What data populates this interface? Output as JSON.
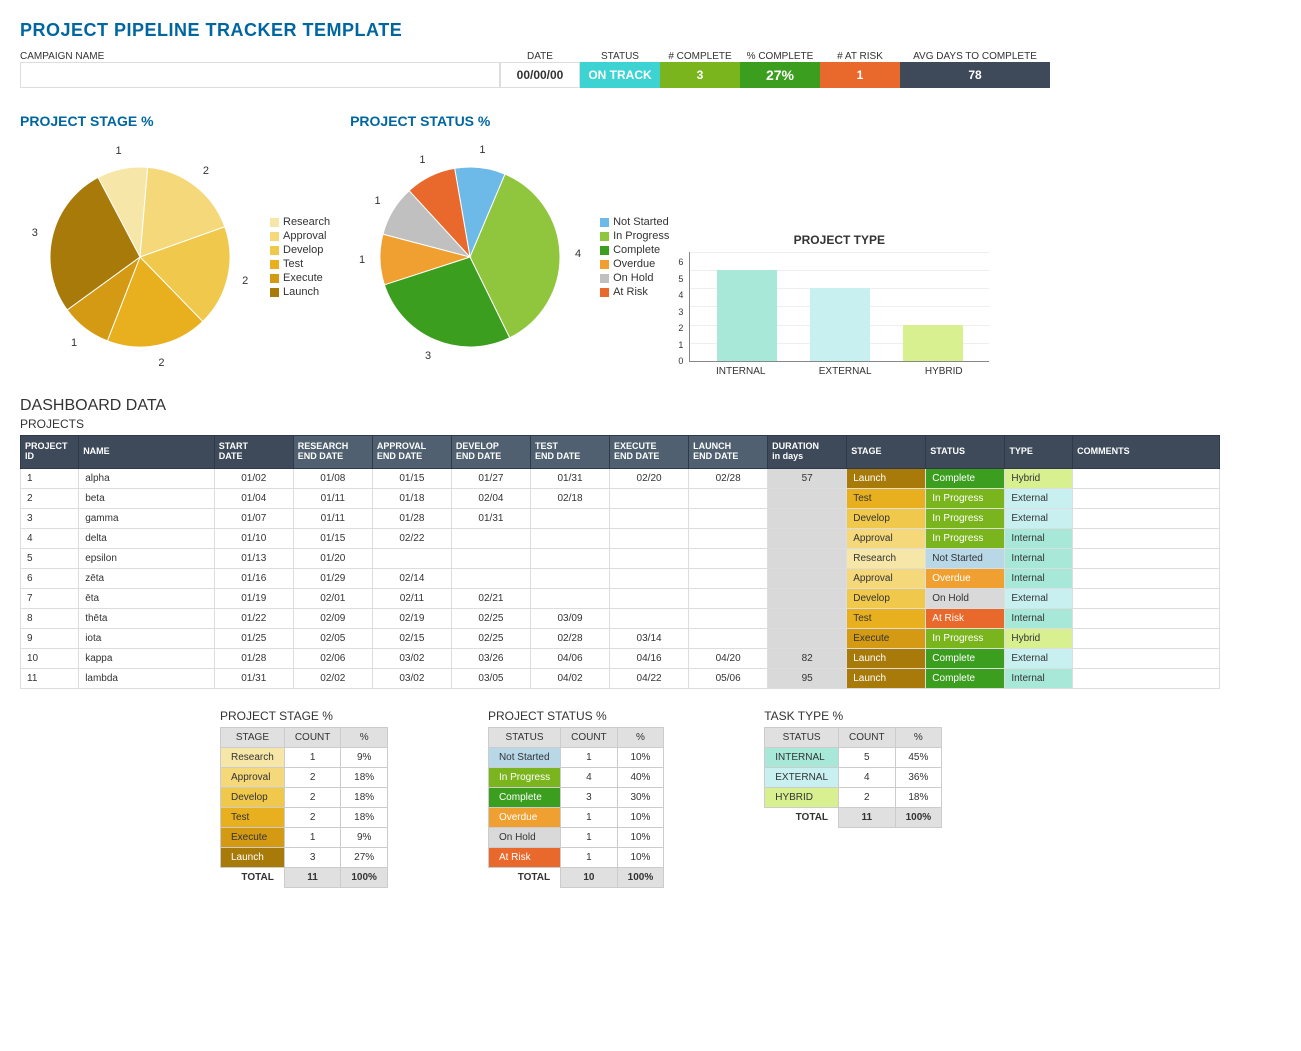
{
  "title": "PROJECT PIPELINE TRACKER TEMPLATE",
  "header": {
    "labels": {
      "campaign": "CAMPAIGN NAME",
      "date": "DATE",
      "status": "STATUS",
      "num_complete": "# COMPLETE",
      "pct_complete": "% COMPLETE",
      "at_risk": "# AT RISK",
      "avg_days": "AVG DAYS TO COMPLETE"
    },
    "values": {
      "date": "00/00/00",
      "status": "ON TRACK",
      "num_complete": "3",
      "pct_complete": "27%",
      "at_risk": "1",
      "avg_days": "78"
    }
  },
  "charts": {
    "stage": {
      "title": "PROJECT STAGE %"
    },
    "status": {
      "title": "PROJECT STATUS %"
    },
    "type": {
      "title": "PROJECT TYPE"
    }
  },
  "chart_data": [
    {
      "type": "pie",
      "title": "PROJECT STAGE %",
      "categories": [
        "Research",
        "Approval",
        "Develop",
        "Test",
        "Execute",
        "Launch"
      ],
      "values": [
        1,
        2,
        2,
        2,
        1,
        3
      ],
      "colors": [
        "#f6e7a8",
        "#f5d87a",
        "#f0c84c",
        "#e8b01e",
        "#d49a14",
        "#a87a0a"
      ]
    },
    {
      "type": "pie",
      "title": "PROJECT STATUS %",
      "categories": [
        "Not Started",
        "In Progress",
        "Complete",
        "Overdue",
        "On Hold",
        "At Risk"
      ],
      "values": [
        1,
        4,
        3,
        1,
        1,
        1
      ],
      "colors": [
        "#6db9e8",
        "#8fc63d",
        "#3c9e1f",
        "#f0a030",
        "#c0c0c0",
        "#e8692b"
      ]
    },
    {
      "type": "bar",
      "title": "PROJECT TYPE",
      "categories": [
        "INTERNAL",
        "EXTERNAL",
        "HYBRID"
      ],
      "values": [
        5,
        4,
        2
      ],
      "colors": [
        "#a8e8d8",
        "#c8f0f0",
        "#d8f090"
      ],
      "ylim": [
        0,
        6
      ],
      "yticks": [
        0,
        1,
        2,
        3,
        4,
        5,
        6
      ]
    }
  ],
  "dashboard_title": "DASHBOARD DATA",
  "projects_title": "PROJECTS",
  "projects": {
    "headers": [
      "PROJECT ID",
      "NAME",
      "START DATE",
      "RESEARCH END DATE",
      "APPROVAL END DATE",
      "DEVELOP END DATE",
      "TEST END DATE",
      "EXECUTE END DATE",
      "LAUNCH END DATE",
      "DURATION in days",
      "STAGE",
      "STATUS",
      "TYPE",
      "COMMENTS"
    ],
    "rows": [
      {
        "id": "1",
        "name": "alpha",
        "start": "01/02",
        "research": "01/08",
        "approval": "01/15",
        "develop": "01/27",
        "test": "01/31",
        "execute": "02/20",
        "launch": "02/28",
        "duration": "57",
        "stage": "Launch",
        "status": "Complete",
        "type": "Hybrid",
        "comments": ""
      },
      {
        "id": "2",
        "name": "beta",
        "start": "01/04",
        "research": "01/11",
        "approval": "01/18",
        "develop": "02/04",
        "test": "02/18",
        "execute": "",
        "launch": "",
        "duration": "",
        "stage": "Test",
        "status": "In Progress",
        "type": "External",
        "comments": ""
      },
      {
        "id": "3",
        "name": "gamma",
        "start": "01/07",
        "research": "01/11",
        "approval": "01/28",
        "develop": "01/31",
        "test": "",
        "execute": "",
        "launch": "",
        "duration": "",
        "stage": "Develop",
        "status": "In Progress",
        "type": "External",
        "comments": ""
      },
      {
        "id": "4",
        "name": "delta",
        "start": "01/10",
        "research": "01/15",
        "approval": "02/22",
        "develop": "",
        "test": "",
        "execute": "",
        "launch": "",
        "duration": "",
        "stage": "Approval",
        "status": "In Progress",
        "type": "Internal",
        "comments": ""
      },
      {
        "id": "5",
        "name": "epsilon",
        "start": "01/13",
        "research": "01/20",
        "approval": "",
        "develop": "",
        "test": "",
        "execute": "",
        "launch": "",
        "duration": "",
        "stage": "Research",
        "status": "Not Started",
        "type": "Internal",
        "comments": ""
      },
      {
        "id": "6",
        "name": "zēta",
        "start": "01/16",
        "research": "01/29",
        "approval": "02/14",
        "develop": "",
        "test": "",
        "execute": "",
        "launch": "",
        "duration": "",
        "stage": "Approval",
        "status": "Overdue",
        "type": "Internal",
        "comments": ""
      },
      {
        "id": "7",
        "name": "ēta",
        "start": "01/19",
        "research": "02/01",
        "approval": "02/11",
        "develop": "02/21",
        "test": "",
        "execute": "",
        "launch": "",
        "duration": "",
        "stage": "Develop",
        "status": "On Hold",
        "type": "External",
        "comments": ""
      },
      {
        "id": "8",
        "name": "thēta",
        "start": "01/22",
        "research": "02/09",
        "approval": "02/19",
        "develop": "02/25",
        "test": "03/09",
        "execute": "",
        "launch": "",
        "duration": "",
        "stage": "Test",
        "status": "At Risk",
        "type": "Internal",
        "comments": ""
      },
      {
        "id": "9",
        "name": "iota",
        "start": "01/25",
        "research": "02/05",
        "approval": "02/15",
        "develop": "02/25",
        "test": "02/28",
        "execute": "03/14",
        "launch": "",
        "duration": "",
        "stage": "Execute",
        "status": "In Progress",
        "type": "Hybrid",
        "comments": ""
      },
      {
        "id": "10",
        "name": "kappa",
        "start": "01/28",
        "research": "02/06",
        "approval": "03/02",
        "develop": "03/26",
        "test": "04/06",
        "execute": "04/16",
        "launch": "04/20",
        "duration": "82",
        "stage": "Launch",
        "status": "Complete",
        "type": "External",
        "comments": ""
      },
      {
        "id": "11",
        "name": "lambda",
        "start": "01/31",
        "research": "02/02",
        "approval": "03/02",
        "develop": "03/05",
        "test": "04/02",
        "execute": "04/22",
        "launch": "05/06",
        "duration": "95",
        "stage": "Launch",
        "status": "Complete",
        "type": "Internal",
        "comments": ""
      }
    ]
  },
  "summary": {
    "stage": {
      "title": "PROJECT STAGE %",
      "headers": [
        "STAGE",
        "COUNT",
        "%"
      ],
      "rows": [
        {
          "label": "Research",
          "count": "1",
          "pct": "9%",
          "cls": "stage-Research"
        },
        {
          "label": "Approval",
          "count": "2",
          "pct": "18%",
          "cls": "stage-Approval"
        },
        {
          "label": "Develop",
          "count": "2",
          "pct": "18%",
          "cls": "stage-Develop"
        },
        {
          "label": "Test",
          "count": "2",
          "pct": "18%",
          "cls": "stage-Test"
        },
        {
          "label": "Execute",
          "count": "1",
          "pct": "9%",
          "cls": "stage-Execute"
        },
        {
          "label": "Launch",
          "count": "3",
          "pct": "27%",
          "cls": "stage-Launch"
        }
      ],
      "total": {
        "label": "TOTAL",
        "count": "11",
        "pct": "100%"
      }
    },
    "status": {
      "title": "PROJECT STATUS %",
      "headers": [
        "STATUS",
        "COUNT",
        "%"
      ],
      "rows": [
        {
          "label": "Not Started",
          "count": "1",
          "pct": "10%",
          "cls": "status-Not-Started"
        },
        {
          "label": "In Progress",
          "count": "4",
          "pct": "40%",
          "cls": "status-In-Progress"
        },
        {
          "label": "Complete",
          "count": "3",
          "pct": "30%",
          "cls": "status-Complete"
        },
        {
          "label": "Overdue",
          "count": "1",
          "pct": "10%",
          "cls": "status-Overdue"
        },
        {
          "label": "On Hold",
          "count": "1",
          "pct": "10%",
          "cls": "status-On-Hold"
        },
        {
          "label": "At Risk",
          "count": "1",
          "pct": "10%",
          "cls": "status-At-Risk"
        }
      ],
      "total": {
        "label": "TOTAL",
        "count": "10",
        "pct": "100%"
      }
    },
    "type": {
      "title": "TASK TYPE %",
      "headers": [
        "STATUS",
        "COUNT",
        "%"
      ],
      "rows": [
        {
          "label": "INTERNAL",
          "count": "5",
          "pct": "45%",
          "cls": "type-Internal"
        },
        {
          "label": "EXTERNAL",
          "count": "4",
          "pct": "36%",
          "cls": "type-External"
        },
        {
          "label": "HYBRID",
          "count": "2",
          "pct": "18%",
          "cls": "type-Hybrid"
        }
      ],
      "total": {
        "label": "TOTAL",
        "count": "11",
        "pct": "100%"
      }
    }
  }
}
